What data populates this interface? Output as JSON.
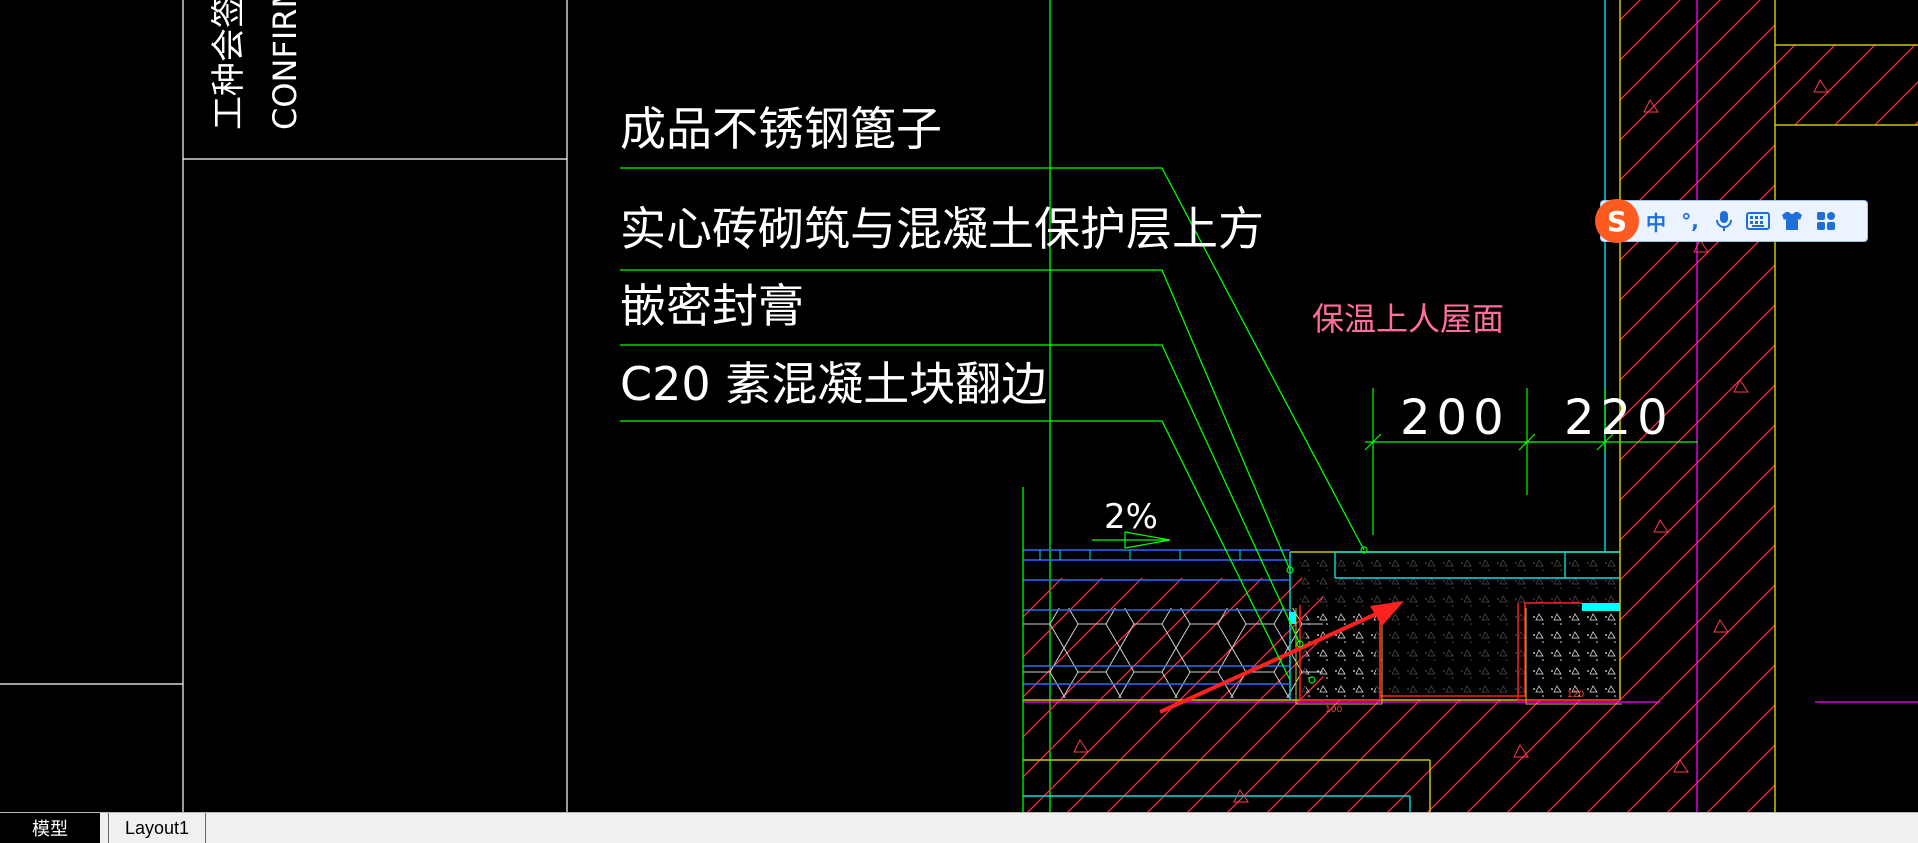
{
  "drawing": {
    "title_block": {
      "sign_text": "工种会签 / 日",
      "confirm_text": "CONFIRM"
    },
    "labels": {
      "label_1": "成品不锈钢篦子",
      "label_2": "实心砖砌筑与混凝土保护层上方",
      "label_3": "嵌密封膏",
      "label_4": "C20 素混凝土块翻边",
      "roof_note": "保温上人屋面",
      "slope": "2%",
      "dim_200": "200",
      "dim_220": "220",
      "small_dim_1": "100",
      "small_dim_2": "120"
    },
    "colors": {
      "green": "#00ff00",
      "yellow": "#c8c800",
      "red": "#ff2020",
      "pink_label": "#ff6f9a",
      "cyan": "#00ffff",
      "blue": "#2060ff",
      "magenta": "#ff00ff",
      "white": "#ffffff"
    }
  },
  "ime_toolbar": {
    "logo": "S",
    "lang": "中",
    "punct": "°,",
    "icons": [
      "microphone-icon",
      "keyboard-icon",
      "skin-icon",
      "toolbox-icon"
    ]
  },
  "layout_tabs": [
    {
      "label": "模型",
      "active": true
    },
    {
      "label": "Layout1",
      "active": false
    }
  ]
}
